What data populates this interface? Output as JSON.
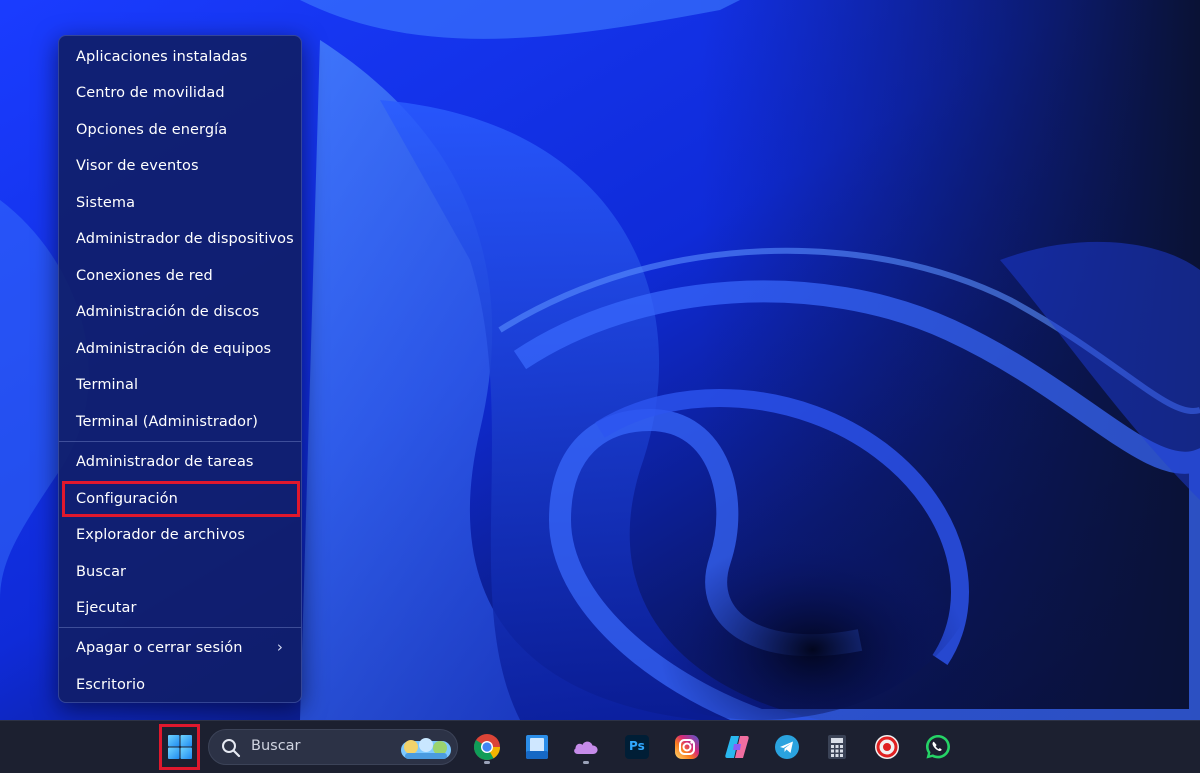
{
  "menu": {
    "items": [
      "Aplicaciones instaladas",
      "Centro de movilidad",
      "Opciones de energía",
      "Visor de eventos",
      "Sistema",
      "Administrador de dispositivos",
      "Conexiones de red",
      "Administración de discos",
      "Administración de equipos",
      "Terminal",
      "Terminal (Administrador)",
      "Administrador de tareas",
      "Configuración",
      "Explorador de archivos",
      "Buscar",
      "Ejecutar",
      "Apagar o cerrar sesión",
      "Escritorio"
    ],
    "highlighted_item": "Configuración",
    "submenu_arrow": "›"
  },
  "taskbar": {
    "search_label": "Buscar",
    "apps": [
      "windows-logo-icon",
      "chrome-icon",
      "file-explorer-icon",
      "onedrive-icon",
      "photoshop-icon",
      "instagram-icon",
      "copilot-icon",
      "telegram-icon",
      "calculator-icon",
      "screen-recorder-icon",
      "whatsapp-icon"
    ],
    "photoshop_label": "Ps"
  },
  "colors": {
    "highlight_border": "#e0182d",
    "menu_bg": "#101e69",
    "taskbar_bg": "#1c2030"
  }
}
